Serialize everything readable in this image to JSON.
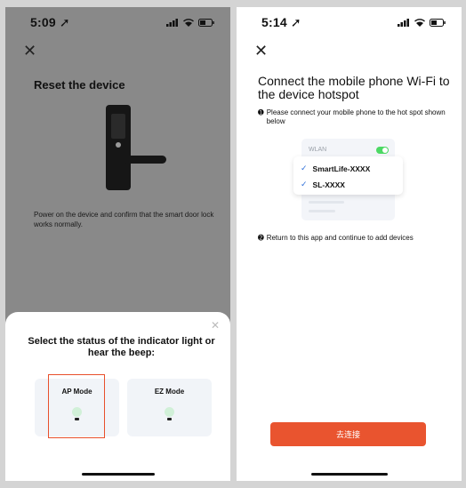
{
  "left_screen": {
    "status": {
      "time": "5:09"
    },
    "title": "Reset the device",
    "description": "Power on the device and confirm that the smart door lock works normally.",
    "sheet": {
      "title": "Select the status of the indicator light or hear the beep:",
      "modes": [
        {
          "label": "AP Mode",
          "selected": true
        },
        {
          "label": "EZ Mode",
          "selected": false
        }
      ]
    }
  },
  "right_screen": {
    "status": {
      "time": "5:14"
    },
    "title": "Connect the mobile phone Wi-Fi to the device hotspot",
    "step1": {
      "num": "➊",
      "text": "Please connect your mobile phone to the hot spot shown below"
    },
    "wlan": {
      "label": "WLAN",
      "networks": [
        "SmartLife-XXXX",
        "SL-XXXX"
      ]
    },
    "step2": {
      "num": "➋",
      "text": "Return to this app and continue to add devices"
    },
    "connect_button": "去连接"
  },
  "icons": {
    "close": "close-icon",
    "check": "check-icon",
    "location": "location-arrow-icon",
    "signal": "signal-icon",
    "wifi": "wifi-icon",
    "battery": "battery-icon"
  },
  "colors": {
    "accent": "#e9542f",
    "toggle_on": "#4cd964",
    "check": "#2f6fd8"
  }
}
